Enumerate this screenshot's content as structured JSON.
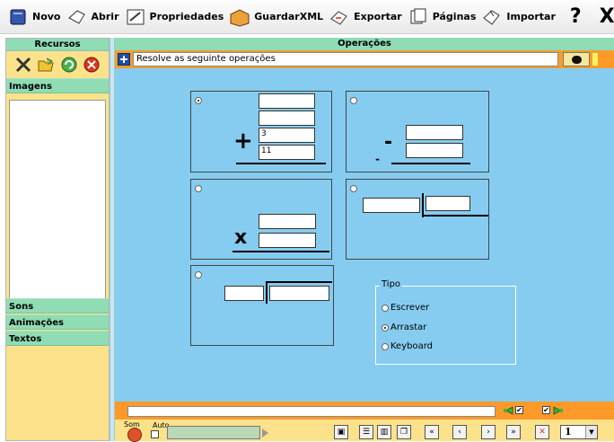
{
  "toolbar": {
    "novo": "Novo",
    "abrir": "Abrir",
    "propriedades": "Propriedades",
    "guardar_xml": "GuardarXML",
    "exportar": "Exportar",
    "paginas": "Páginas",
    "importar": "Importar",
    "help": "?",
    "close": "X"
  },
  "left_panel": {
    "header": "Recursos",
    "sections": {
      "imagens": "Imagens",
      "sons": "Sons",
      "animacoes": "Animações",
      "textos": "Textos"
    }
  },
  "main": {
    "header": "Operações",
    "instruction": "Resolve as seguinte operações",
    "addition": {
      "symbol": "+",
      "field3": "3",
      "field4": "11"
    },
    "subtraction": {
      "symbol": "-",
      "symbol2": "-"
    },
    "multiplication": {
      "symbol": "x"
    },
    "tipo": {
      "label": "Tipo",
      "options": [
        "Escrever",
        "Arrastar",
        "Keyboard"
      ],
      "selected": "Arrastar"
    }
  },
  "bottom": {
    "som_label": "Som",
    "auto_label": "Auto",
    "page_number": "1",
    "checkbox_mark": "✔",
    "progress": 0
  },
  "colors": {
    "main_bg": "#86ccf0",
    "header_green": "#8fdcb5",
    "panel_yellow": "#fce28a",
    "orange": "#ff9a2a"
  }
}
